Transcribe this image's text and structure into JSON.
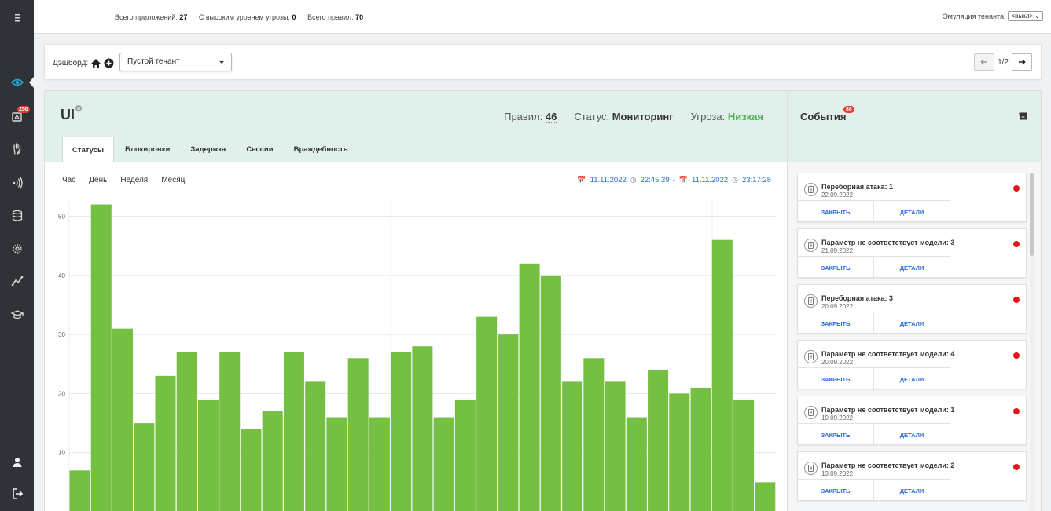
{
  "topbar": {
    "stats": [
      {
        "label": "Всего приложений:",
        "value": "27"
      },
      {
        "label": "С высоким уровнем угрозы:",
        "value": "0"
      },
      {
        "label": "Всего правил:",
        "value": "70"
      }
    ],
    "tenant_emulation_label": "Эмуляция тенанта:",
    "tenant_emulation_value": "<выкл>"
  },
  "sidebar": {
    "icons": [
      "menu-icon",
      "eye-icon",
      "alerts-icon",
      "hand-icon",
      "signal-icon",
      "database-icon",
      "settings-icon",
      "analytics-icon",
      "learning-icon",
      "user-icon",
      "logout-icon"
    ],
    "alerts_badge": "250"
  },
  "dashboard": {
    "label": "Дэшборд:",
    "selected_tenant": "Пустой тенант",
    "page": "1/2"
  },
  "app": {
    "title": "UI",
    "rules_label": "Правил:",
    "rules_value": "46",
    "status_label": "Статус:",
    "status_value": "Мониторинг",
    "threat_label": "Угроза:",
    "threat_value": "Низкая",
    "threat_color": "#4caf50",
    "tabs": [
      "Статусы",
      "Блокировки",
      "Задержка",
      "Сессии",
      "Враждебность"
    ],
    "active_tab": "Статусы",
    "periods": [
      "Час",
      "День",
      "Неделя",
      "Месяц"
    ],
    "range": {
      "from_date": "11.11.2022",
      "from_time": "22:45:29",
      "separator": "-",
      "to_date": "11.11.2022",
      "to_time": "23:17:28"
    }
  },
  "chart_data": {
    "type": "bar",
    "categories": [],
    "values": [
      7,
      52,
      31,
      15,
      23,
      27,
      19,
      27,
      14,
      17,
      27,
      22,
      16,
      26,
      16,
      27,
      28,
      16,
      19,
      33,
      30,
      42,
      40,
      22,
      26,
      22,
      16,
      24,
      20,
      21,
      46,
      19,
      5
    ],
    "yticks": [
      10,
      20,
      30,
      40,
      50
    ],
    "ylim": [
      0,
      53
    ],
    "grid": true,
    "bar_color": "#75c043"
  },
  "events": {
    "title": "События",
    "badge": "88",
    "close_label": "ЗАКРЫТЬ",
    "details_label": "ДЕТАЛИ",
    "items": [
      {
        "title": "Переборная атака: 1",
        "date": "22.09.2022"
      },
      {
        "title": "Параметр не соответствует модели: 3",
        "date": "21.09.2022"
      },
      {
        "title": "Переборная атака: 3",
        "date": "20.09.2022"
      },
      {
        "title": "Параметр не соответствует модели: 4",
        "date": "20.09.2022"
      },
      {
        "title": "Параметр не соответствует модели: 1",
        "date": "19.09.2022"
      },
      {
        "title": "Параметр не соответствует модели: 2",
        "date": "13.09.2022"
      }
    ]
  }
}
